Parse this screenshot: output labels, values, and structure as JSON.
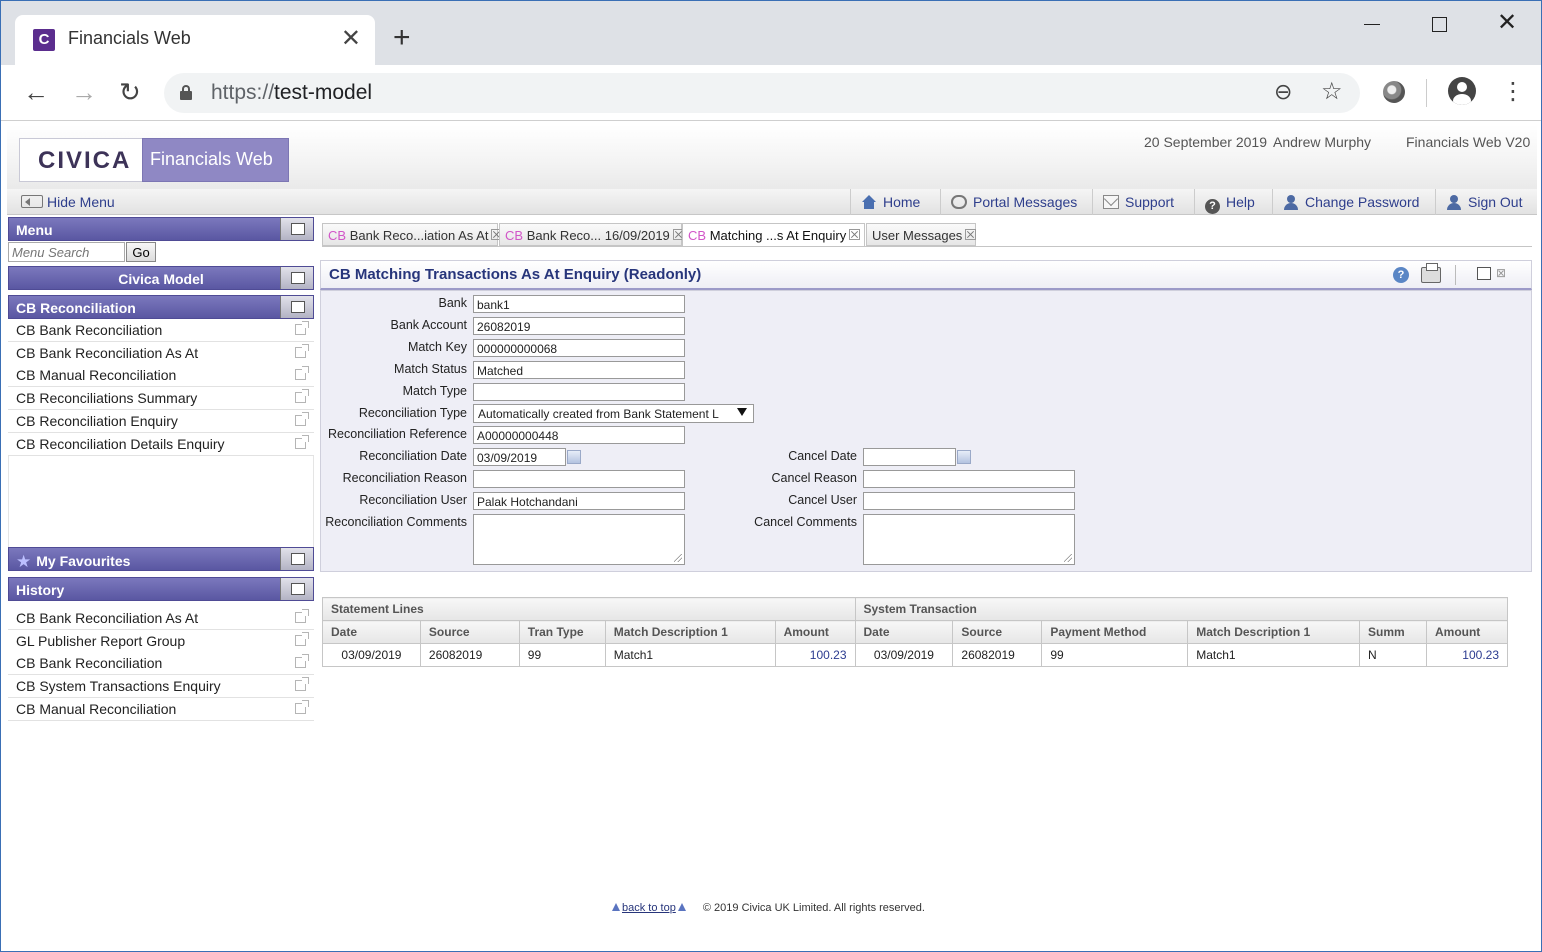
{
  "browser": {
    "tab_title": "Financials Web",
    "favicon_letter": "C",
    "url_scheme": "https://",
    "url_host": "test-model"
  },
  "header": {
    "logo": "CIVICA",
    "product": "Financials Web",
    "date": "20 September 2019",
    "user": "Andrew Murphy",
    "version": "Financials Web V20"
  },
  "nav": {
    "hide_menu": "Hide Menu",
    "links": [
      "Home",
      "Portal Messages",
      "Support",
      "Help",
      "Change Password",
      "Sign Out"
    ]
  },
  "sidebar": {
    "menu_title": "Menu",
    "search_placeholder": "Menu Search",
    "go_label": "Go",
    "model_title": "Civica Model",
    "section_title": "CB Reconciliation",
    "items": [
      "CB Bank Reconciliation",
      "CB Bank Reconciliation As At",
      "CB Manual Reconciliation",
      "CB Reconciliations Summary",
      "CB Reconciliation Enquiry",
      "CB Reconciliation Details Enquiry"
    ],
    "favourites_title": "My Favourites",
    "history_title": "History",
    "history": [
      "CB Bank Reconciliation As At",
      "GL Publisher Report Group",
      "CB Bank Reconciliation",
      "CB System Transactions Enquiry",
      "CB Manual Reconciliation"
    ]
  },
  "tabs": [
    {
      "prefix": "CB",
      "label": "Bank Reco...iation As At"
    },
    {
      "prefix": "CB",
      "label": "Bank Reco... 16/09/2019"
    },
    {
      "prefix": "CB",
      "label": "Matching ...s At Enquiry"
    },
    {
      "prefix": "",
      "label": "User Messages"
    }
  ],
  "form": {
    "title": "CB Matching Transactions As At Enquiry (Readonly)",
    "labels": {
      "bank": "Bank",
      "bank_account": "Bank Account",
      "match_key": "Match Key",
      "match_status": "Match Status",
      "match_type": "Match Type",
      "reconciliation_type": "Reconciliation Type",
      "reconciliation_reference": "Reconciliation Reference",
      "reconciliation_date": "Reconciliation Date",
      "reconciliation_reason": "Reconciliation Reason",
      "reconciliation_user": "Reconciliation User",
      "reconciliation_comments": "Reconciliation Comments",
      "cancel_date": "Cancel Date",
      "cancel_reason": "Cancel Reason",
      "cancel_user": "Cancel User",
      "cancel_comments": "Cancel Comments"
    },
    "values": {
      "bank": "bank1",
      "bank_account": "26082019",
      "match_key": "000000000068",
      "match_status": "Matched",
      "match_type": "",
      "reconciliation_type": "Automatically created from Bank Statement L",
      "reconciliation_reference": "A00000000448",
      "reconciliation_date": "03/09/2019",
      "reconciliation_reason": "",
      "reconciliation_user": "Palak Hotchandani",
      "cancel_date": "",
      "cancel_reason": "",
      "cancel_user": ""
    }
  },
  "grid": {
    "groups": [
      "Statement Lines",
      "System Transaction"
    ],
    "columns": [
      "Date",
      "Source",
      "Tran Type",
      "Match Description 1",
      "Amount",
      "Date",
      "Source",
      "Payment Method",
      "Match Description 1",
      "Summ",
      "Amount"
    ],
    "rows": [
      [
        "03/09/2019",
        "26082019",
        "99",
        "Match1",
        "100.23",
        "03/09/2019",
        "26082019",
        "99",
        "Match1",
        "N",
        "100.23"
      ]
    ]
  },
  "footer": {
    "back_to_top": "back to top",
    "copyright": "© 2019 Civica UK Limited. All rights reserved."
  }
}
